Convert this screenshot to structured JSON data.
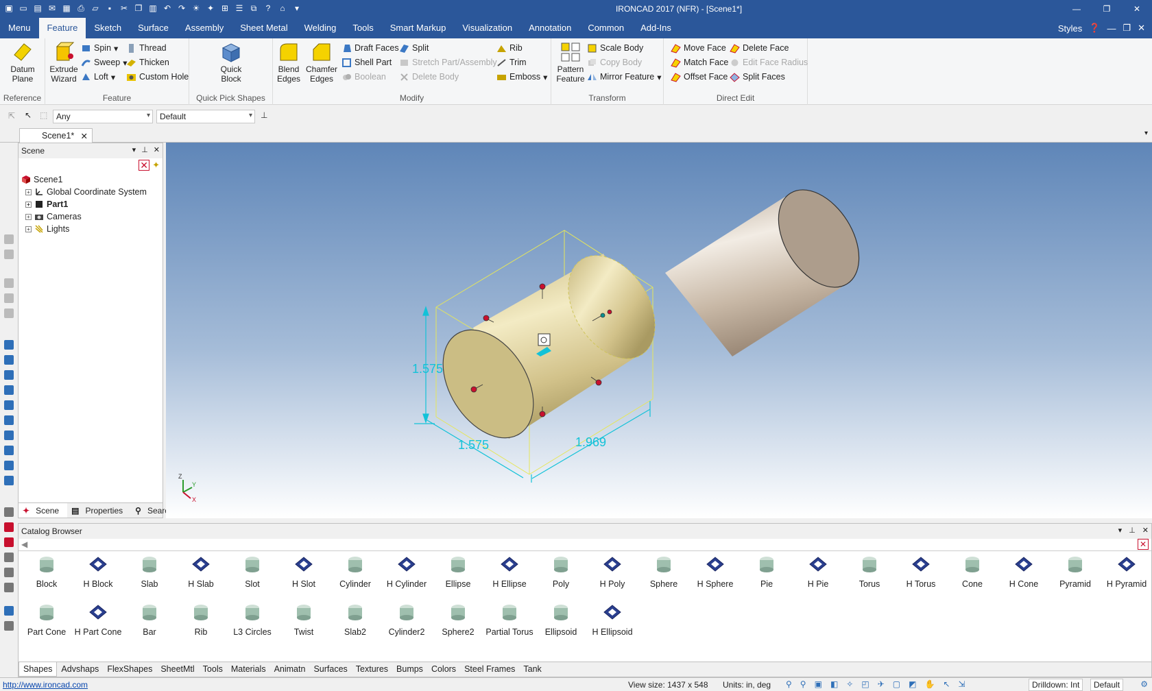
{
  "window": {
    "title": "IRONCAD 2017 (NFR) - [Scene1*]"
  },
  "menu": {
    "tabs": [
      "Menu",
      "Feature",
      "Sketch",
      "Surface",
      "Assembly",
      "Sheet Metal",
      "Welding",
      "Tools",
      "Smart Markup",
      "Visualization",
      "Annotation",
      "Common",
      "Add-Ins"
    ],
    "active": "Feature",
    "styles": "Styles"
  },
  "ribbon": {
    "reference": {
      "label": "Reference",
      "datum": "Datum\nPlane"
    },
    "feature": {
      "label": "Feature",
      "extrude": "Extrude\nWizard",
      "spin": "Spin",
      "sweep": "Sweep",
      "loft": "Loft",
      "thread": "Thread",
      "thicken": "Thicken",
      "custom_hole": "Custom Hole"
    },
    "quick": {
      "label": "Quick Pick Shapes",
      "quick_block": "Quick\nBlock"
    },
    "modify": {
      "label": "Modify",
      "blend": "Blend\nEdges",
      "chamfer": "Chamfer\nEdges",
      "draft": "Draft Faces",
      "shell": "Shell Part",
      "boolean": "Boolean",
      "split": "Split",
      "stretch": "Stretch Part/Assembly",
      "delete_body": "Delete Body",
      "rib": "Rib",
      "trim": "Trim",
      "emboss": "Emboss"
    },
    "transform": {
      "label": "Transform",
      "pattern": "Pattern\nFeature",
      "scale": "Scale Body",
      "copy": "Copy Body",
      "mirror": "Mirror Feature"
    },
    "direct": {
      "label": "Direct Edit",
      "move_face": "Move Face",
      "match_face": "Match Face",
      "offset_face": "Offset Face",
      "delete_face": "Delete Face",
      "edit_radius": "Edit Face Radius",
      "split_faces": "Split Faces"
    }
  },
  "toolbar": {
    "filter": "Any",
    "style": "Default"
  },
  "document": {
    "tab": "Scene1*"
  },
  "scene_panel": {
    "title": "Scene",
    "tree": [
      {
        "label": "Scene1",
        "bold": false,
        "expandable": false
      },
      {
        "label": "Global Coordinate System",
        "bold": false,
        "expandable": true
      },
      {
        "label": "Part1",
        "bold": true,
        "expandable": true
      },
      {
        "label": "Cameras",
        "bold": false,
        "expandable": true
      },
      {
        "label": "Lights",
        "bold": false,
        "expandable": true
      }
    ],
    "tabs": [
      "Scene",
      "Properties",
      "Search"
    ]
  },
  "viewport": {
    "dimensions": {
      "height": "1.575",
      "width": "1.575",
      "length": "1.969"
    },
    "axes": {
      "z": "Z",
      "y": "Y",
      "x": "X"
    },
    "colors": {
      "body": "#d9cfa0",
      "rod": "#c8b9a8",
      "handles": "#c8102e",
      "dims": "#12c2d8"
    }
  },
  "catalog": {
    "title": "Catalog Browser",
    "shapes_row1": [
      "Block",
      "H Block",
      "Slab",
      "H Slab",
      "Slot",
      "H Slot",
      "Cylinder",
      "H Cylinder",
      "Ellipse",
      "H Ellipse",
      "Poly",
      "H Poly",
      "Sphere",
      "H Sphere",
      "Pie",
      "H Pie",
      "Torus",
      "H Torus",
      "Cone",
      "H Cone",
      "Pyramid",
      "H Pyramid"
    ],
    "shapes_row2": [
      "Part Cone",
      "H Part Cone",
      "Bar",
      "Rib",
      "L3 Circles",
      "Twist",
      "Slab2",
      "Cylinder2",
      "Sphere2",
      "Partial Torus",
      "Ellipsoid",
      "H Ellipsoid"
    ],
    "tabs": [
      "Shapes",
      "Advshaps",
      "FlexShapes",
      "SheetMtl",
      "Tools",
      "Materials",
      "Animatn",
      "Surfaces",
      "Textures",
      "Bumps",
      "Colors",
      "Steel Frames",
      "Tank"
    ]
  },
  "status": {
    "url": "http://www.ironcad.com",
    "view_size": "View size: 1437 x  548",
    "units": "Units: in, deg",
    "drilldown": "Drilldown: Int",
    "default": "Default"
  }
}
